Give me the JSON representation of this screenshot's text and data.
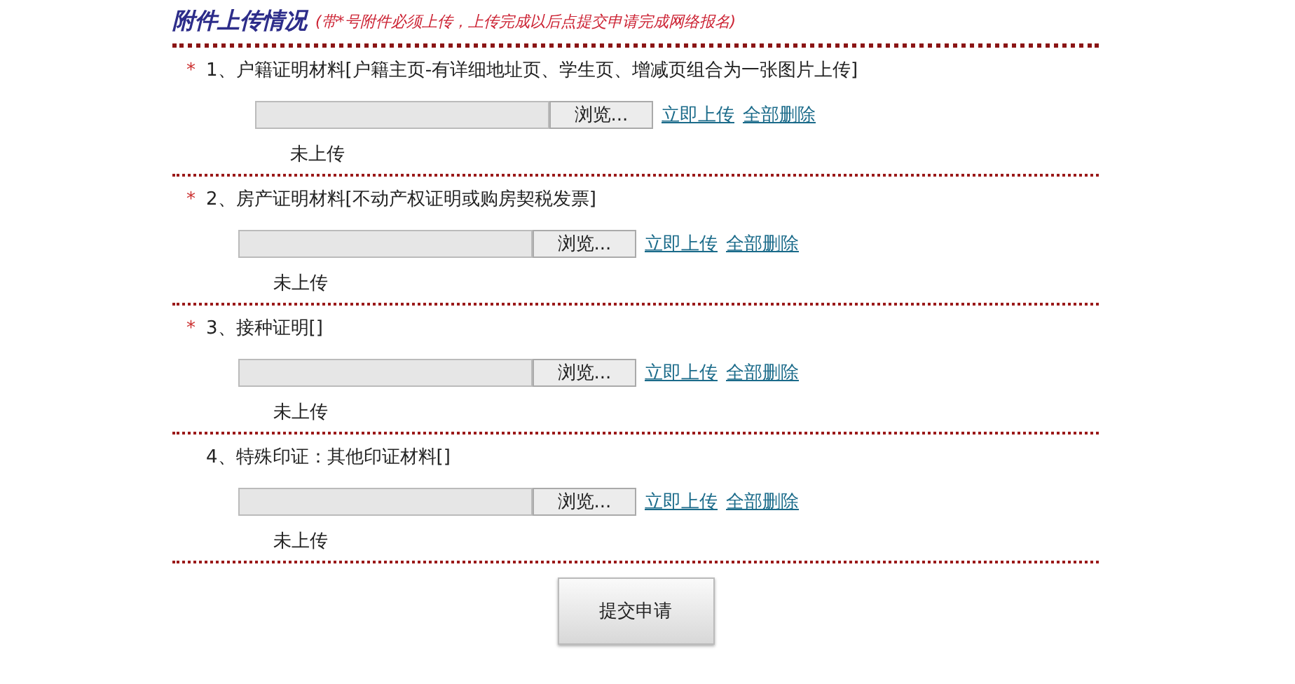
{
  "section": {
    "title": "附件上传情况",
    "hint": "(带*号附件必须上传，上传完成以后点提交申请完成网络报名)"
  },
  "items": [
    {
      "required": true,
      "required_mark": "*",
      "label": "1、户籍证明材料[户籍主页-有详细地址页、学生页、增减页组合为一张图片上传]",
      "browse_button": "浏览...",
      "upload_link": "立即上传",
      "delete_link": "全部删除",
      "status": "未上传"
    },
    {
      "required": true,
      "required_mark": "*",
      "label": "2、房产证明材料[不动产权证明或购房契税发票]",
      "browse_button": "浏览...",
      "upload_link": "立即上传",
      "delete_link": "全部删除",
      "status": "未上传"
    },
    {
      "required": true,
      "required_mark": "*",
      "label": "3、接种证明[]",
      "browse_button": "浏览...",
      "upload_link": "立即上传",
      "delete_link": "全部删除",
      "status": "未上传"
    },
    {
      "required": false,
      "label": "4、特殊印证：其他印证材料[]",
      "browse_button": "浏览...",
      "upload_link": "立即上传",
      "delete_link": "全部删除",
      "status": "未上传"
    }
  ],
  "submit_button": "提交申请"
}
